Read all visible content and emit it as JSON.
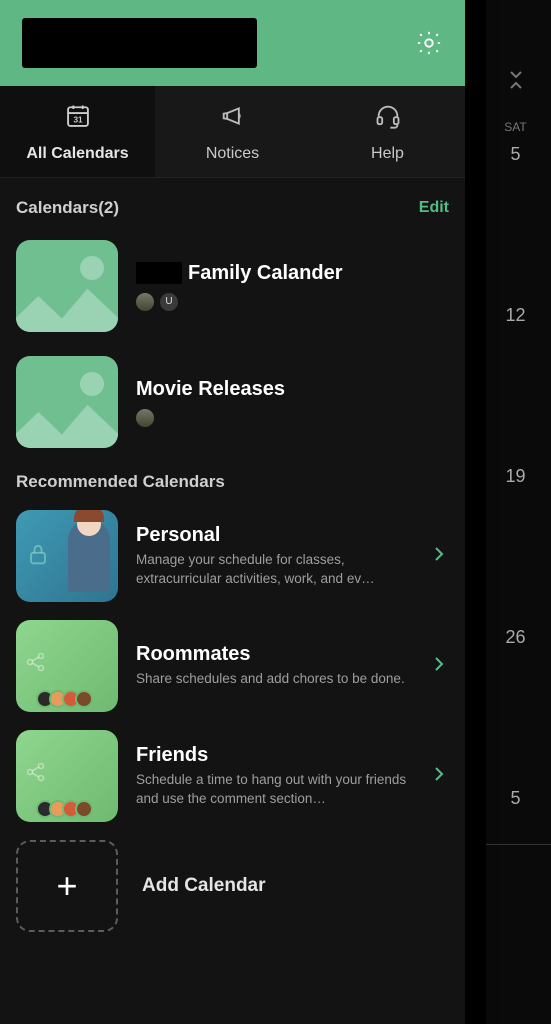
{
  "background": {
    "day_label": "SAT",
    "dates": [
      "5",
      "12",
      "19",
      "26",
      "5"
    ]
  },
  "tabs": {
    "all_calendars": "All Calendars",
    "notices": "Notices",
    "help": "Help"
  },
  "calendars": {
    "heading": "Calendars(2)",
    "edit": "Edit",
    "items": [
      {
        "title_suffix": "Family Calander",
        "members": [
          "",
          "U"
        ]
      },
      {
        "title": "Movie Releases",
        "members": [
          ""
        ]
      }
    ]
  },
  "recommended": {
    "heading": "Recommended Calendars",
    "items": [
      {
        "title": "Personal",
        "desc": "Manage your schedule for classes, extracurricular activities, work, and ev…"
      },
      {
        "title": "Roommates",
        "desc": "Share schedules and add chores to be done."
      },
      {
        "title": "Friends",
        "desc": "Schedule a time to hang out with your friends and use the comment section…"
      }
    ]
  },
  "add_calendar": {
    "label": "Add Calendar"
  }
}
